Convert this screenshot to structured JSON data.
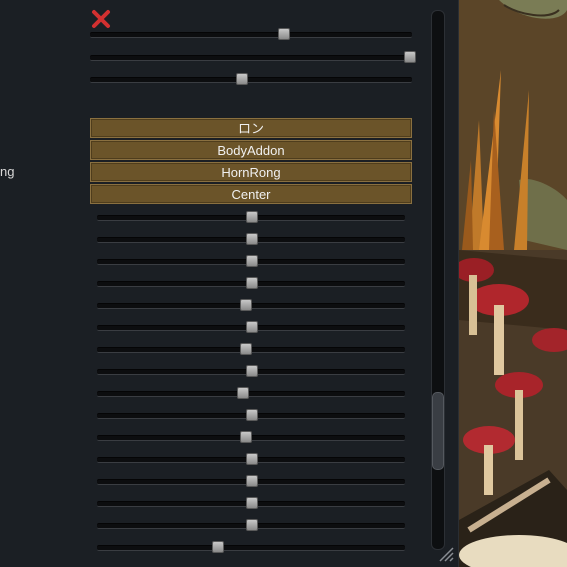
{
  "side_label": "ng",
  "tabs": [
    "ロン",
    "BodyAddon",
    "HornRong",
    "Center"
  ],
  "top_sliders": [
    0.6,
    0.99,
    0.47
  ],
  "sliders": [
    0.5,
    0.5,
    0.5,
    0.5,
    0.48,
    0.5,
    0.48,
    0.5,
    0.47,
    0.5,
    0.48,
    0.5,
    0.5,
    0.5,
    0.5,
    0.39
  ],
  "scroll_position": 0.75,
  "colors": {
    "tab_bg": "#6b5429",
    "close": "#d23030",
    "panel": "#1b1f24"
  }
}
